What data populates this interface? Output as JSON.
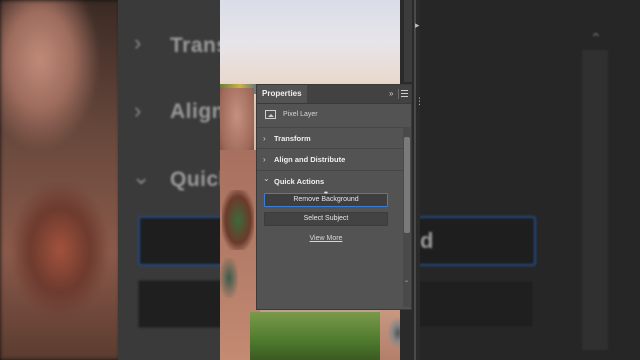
{
  "panel": {
    "tab_title": "Properties",
    "collapse_glyph": "»",
    "layer_type": "Pixel Layer",
    "sections": [
      {
        "label": "Transform",
        "chevron": "›"
      },
      {
        "label": "Align and Distribute",
        "chevron": "›"
      },
      {
        "label": "Quick Actions",
        "chevron": "⌄"
      }
    ],
    "buttons": {
      "remove_background": "Remove Background",
      "select_subject": "Select Subject"
    },
    "loading_indicator": "••",
    "view_more": "View More"
  },
  "background_zoom": {
    "row1": "Trans",
    "row2": "Align",
    "row3": "Quick",
    "right_text": "d"
  },
  "colors": {
    "panel_bg": "#535353",
    "focus_border": "#3d7bd9",
    "button_bg": "#434343"
  }
}
